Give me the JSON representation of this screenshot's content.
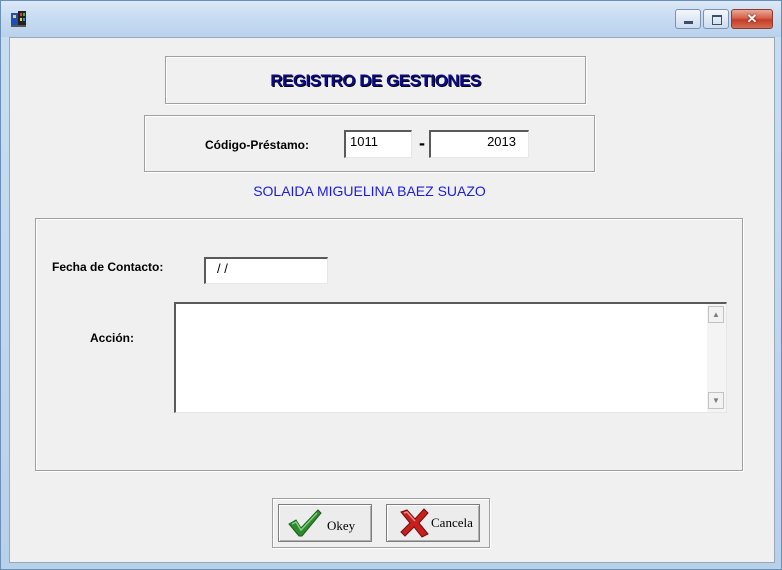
{
  "window": {
    "title": ""
  },
  "form": {
    "heading": "REGISTRO DE GESTIONES",
    "codigo_label": "Código-Préstamo:",
    "codigo_part1": "1011",
    "codigo_separator": "-",
    "codigo_part2": "2013",
    "client_name": "SOLAIDA MIGUELINA BAEZ SUAZO",
    "fecha_label": "Fecha de Contacto:",
    "fecha_value": "/ /",
    "accion_label": "Acción:",
    "accion_value": ""
  },
  "buttons": {
    "ok_label": "Okey",
    "cancel_label": "Cancela"
  },
  "icons": {
    "app": "app-icon",
    "ok": "checkmark-icon",
    "cancel": "x-icon"
  },
  "colors": {
    "heading": "#0b0b8a",
    "client_name": "#1c1ce0",
    "ok_check": "#2e8b2e",
    "cancel_x": "#c81e1e"
  }
}
